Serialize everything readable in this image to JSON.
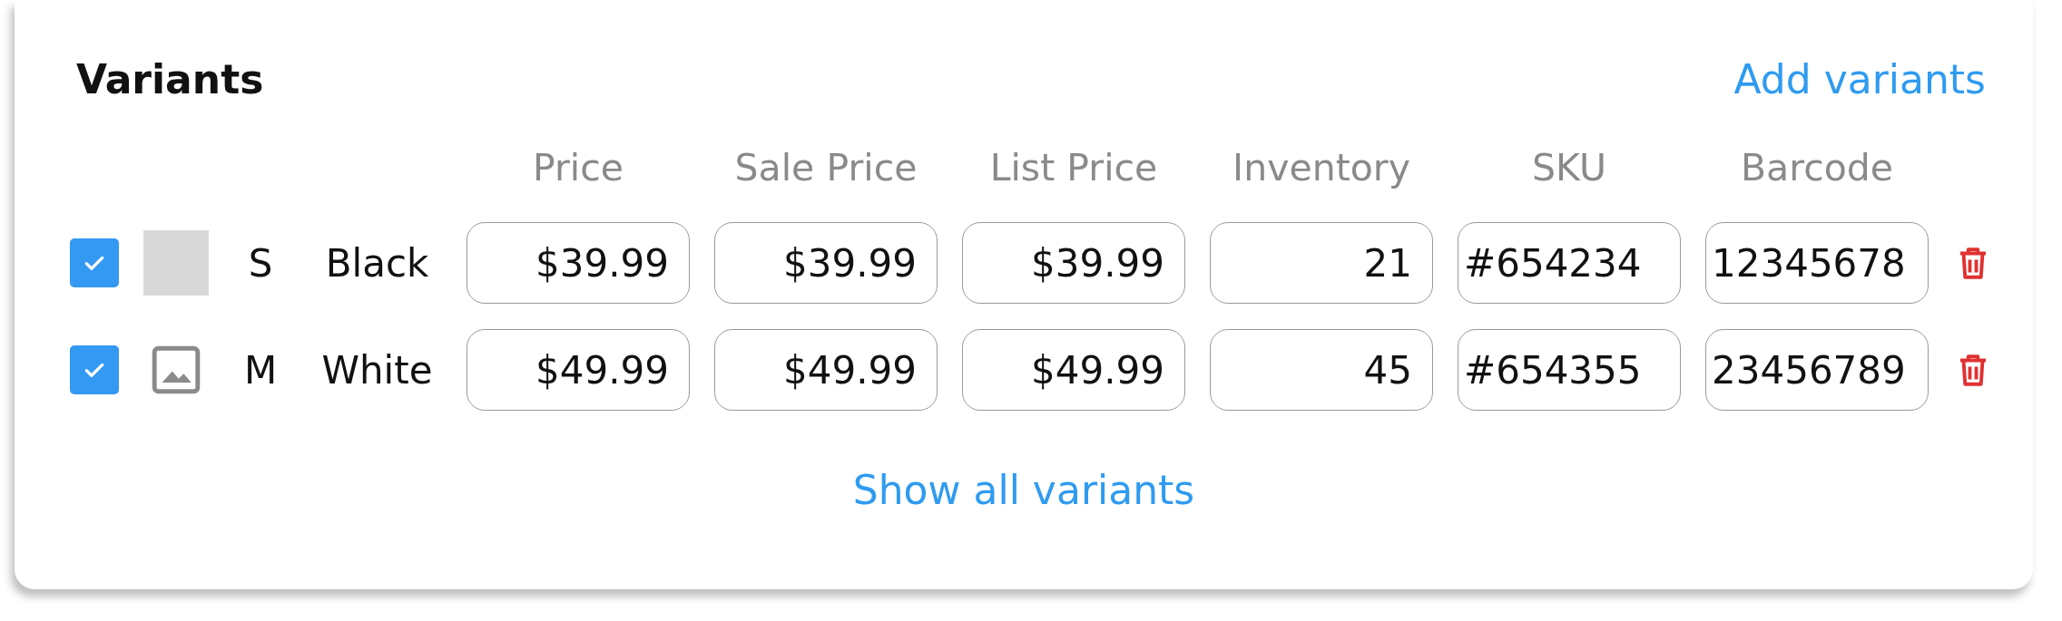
{
  "title": "Variants",
  "add_link": "Add variants",
  "columns": [
    "Price",
    "Sale Price",
    "List Price",
    "Inventory",
    "SKU",
    "Barcode"
  ],
  "variants": [
    {
      "checked": true,
      "thumbnail": {
        "kind": "swatch"
      },
      "size": "S",
      "color_name": "Black",
      "fields": [
        "$39.99",
        "$39.99",
        "$39.99",
        "21",
        "#654234",
        "12345678"
      ]
    },
    {
      "checked": true,
      "thumbnail": {
        "kind": "placeholder"
      },
      "size": "M",
      "color_name": "White",
      "fields": [
        "$49.99",
        "$49.99",
        "$49.99",
        "45",
        "#654355",
        "23456789"
      ]
    }
  ],
  "show_all_link": "Show all variants"
}
